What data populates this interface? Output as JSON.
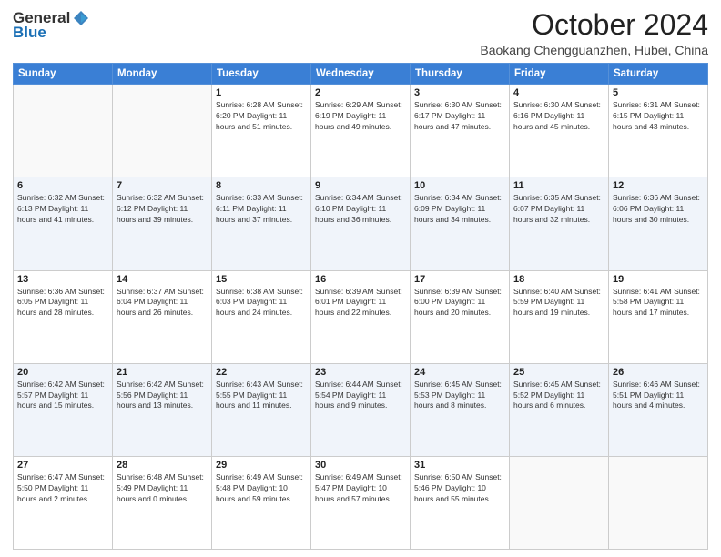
{
  "header": {
    "logo_general": "General",
    "logo_blue": "Blue",
    "month": "October 2024",
    "location": "Baokang Chengguanzhen, Hubei, China"
  },
  "weekdays": [
    "Sunday",
    "Monday",
    "Tuesday",
    "Wednesday",
    "Thursday",
    "Friday",
    "Saturday"
  ],
  "weeks": [
    [
      {
        "day": "",
        "info": ""
      },
      {
        "day": "",
        "info": ""
      },
      {
        "day": "1",
        "info": "Sunrise: 6:28 AM\nSunset: 6:20 PM\nDaylight: 11 hours and 51 minutes."
      },
      {
        "day": "2",
        "info": "Sunrise: 6:29 AM\nSunset: 6:19 PM\nDaylight: 11 hours and 49 minutes."
      },
      {
        "day": "3",
        "info": "Sunrise: 6:30 AM\nSunset: 6:17 PM\nDaylight: 11 hours and 47 minutes."
      },
      {
        "day": "4",
        "info": "Sunrise: 6:30 AM\nSunset: 6:16 PM\nDaylight: 11 hours and 45 minutes."
      },
      {
        "day": "5",
        "info": "Sunrise: 6:31 AM\nSunset: 6:15 PM\nDaylight: 11 hours and 43 minutes."
      }
    ],
    [
      {
        "day": "6",
        "info": "Sunrise: 6:32 AM\nSunset: 6:13 PM\nDaylight: 11 hours and 41 minutes."
      },
      {
        "day": "7",
        "info": "Sunrise: 6:32 AM\nSunset: 6:12 PM\nDaylight: 11 hours and 39 minutes."
      },
      {
        "day": "8",
        "info": "Sunrise: 6:33 AM\nSunset: 6:11 PM\nDaylight: 11 hours and 37 minutes."
      },
      {
        "day": "9",
        "info": "Sunrise: 6:34 AM\nSunset: 6:10 PM\nDaylight: 11 hours and 36 minutes."
      },
      {
        "day": "10",
        "info": "Sunrise: 6:34 AM\nSunset: 6:09 PM\nDaylight: 11 hours and 34 minutes."
      },
      {
        "day": "11",
        "info": "Sunrise: 6:35 AM\nSunset: 6:07 PM\nDaylight: 11 hours and 32 minutes."
      },
      {
        "day": "12",
        "info": "Sunrise: 6:36 AM\nSunset: 6:06 PM\nDaylight: 11 hours and 30 minutes."
      }
    ],
    [
      {
        "day": "13",
        "info": "Sunrise: 6:36 AM\nSunset: 6:05 PM\nDaylight: 11 hours and 28 minutes."
      },
      {
        "day": "14",
        "info": "Sunrise: 6:37 AM\nSunset: 6:04 PM\nDaylight: 11 hours and 26 minutes."
      },
      {
        "day": "15",
        "info": "Sunrise: 6:38 AM\nSunset: 6:03 PM\nDaylight: 11 hours and 24 minutes."
      },
      {
        "day": "16",
        "info": "Sunrise: 6:39 AM\nSunset: 6:01 PM\nDaylight: 11 hours and 22 minutes."
      },
      {
        "day": "17",
        "info": "Sunrise: 6:39 AM\nSunset: 6:00 PM\nDaylight: 11 hours and 20 minutes."
      },
      {
        "day": "18",
        "info": "Sunrise: 6:40 AM\nSunset: 5:59 PM\nDaylight: 11 hours and 19 minutes."
      },
      {
        "day": "19",
        "info": "Sunrise: 6:41 AM\nSunset: 5:58 PM\nDaylight: 11 hours and 17 minutes."
      }
    ],
    [
      {
        "day": "20",
        "info": "Sunrise: 6:42 AM\nSunset: 5:57 PM\nDaylight: 11 hours and 15 minutes."
      },
      {
        "day": "21",
        "info": "Sunrise: 6:42 AM\nSunset: 5:56 PM\nDaylight: 11 hours and 13 minutes."
      },
      {
        "day": "22",
        "info": "Sunrise: 6:43 AM\nSunset: 5:55 PM\nDaylight: 11 hours and 11 minutes."
      },
      {
        "day": "23",
        "info": "Sunrise: 6:44 AM\nSunset: 5:54 PM\nDaylight: 11 hours and 9 minutes."
      },
      {
        "day": "24",
        "info": "Sunrise: 6:45 AM\nSunset: 5:53 PM\nDaylight: 11 hours and 8 minutes."
      },
      {
        "day": "25",
        "info": "Sunrise: 6:45 AM\nSunset: 5:52 PM\nDaylight: 11 hours and 6 minutes."
      },
      {
        "day": "26",
        "info": "Sunrise: 6:46 AM\nSunset: 5:51 PM\nDaylight: 11 hours and 4 minutes."
      }
    ],
    [
      {
        "day": "27",
        "info": "Sunrise: 6:47 AM\nSunset: 5:50 PM\nDaylight: 11 hours and 2 minutes."
      },
      {
        "day": "28",
        "info": "Sunrise: 6:48 AM\nSunset: 5:49 PM\nDaylight: 11 hours and 0 minutes."
      },
      {
        "day": "29",
        "info": "Sunrise: 6:49 AM\nSunset: 5:48 PM\nDaylight: 10 hours and 59 minutes."
      },
      {
        "day": "30",
        "info": "Sunrise: 6:49 AM\nSunset: 5:47 PM\nDaylight: 10 hours and 57 minutes."
      },
      {
        "day": "31",
        "info": "Sunrise: 6:50 AM\nSunset: 5:46 PM\nDaylight: 10 hours and 55 minutes."
      },
      {
        "day": "",
        "info": ""
      },
      {
        "day": "",
        "info": ""
      }
    ]
  ]
}
